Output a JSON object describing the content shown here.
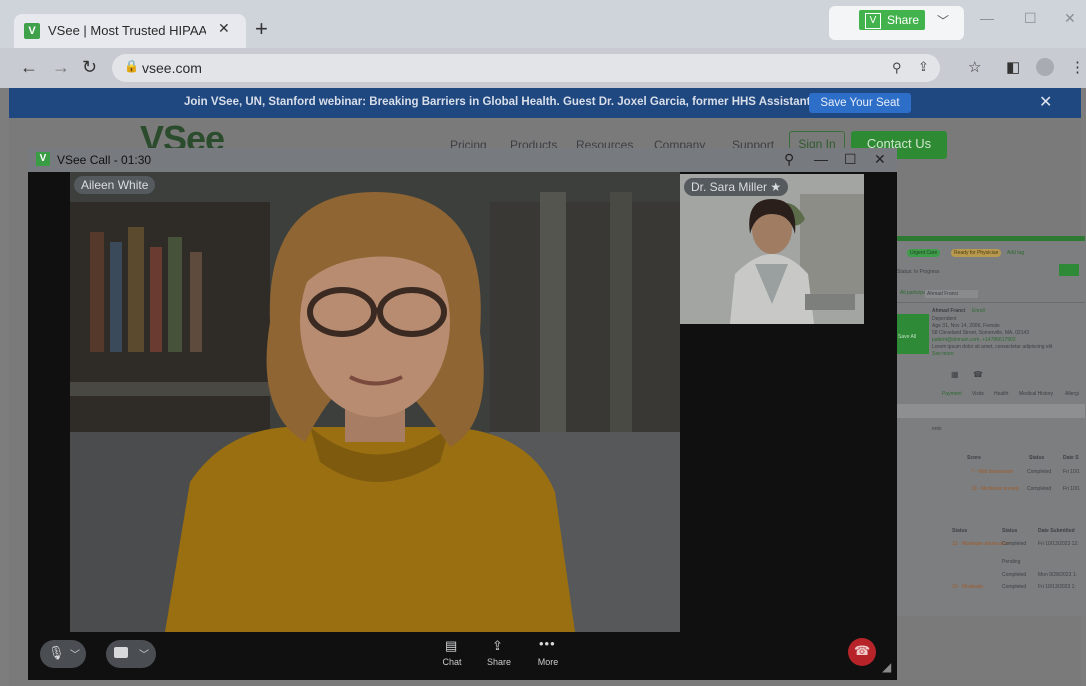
{
  "browser": {
    "tab_title": "VSee | Most Trusted HIPAA Com",
    "url": "vsee.com",
    "share_label": "Share"
  },
  "banner": {
    "message": "Join VSee, UN, Stanford webinar: Breaking Barriers in Global Health. Guest Dr. Joxel Garcia, former HHS Assistant Secretary",
    "cta": "Save Your Seat"
  },
  "site": {
    "logo": "VSee",
    "nav": [
      "Pricing",
      "Products",
      "Resources",
      "Company",
      "Support"
    ],
    "sign_in": "Sign In",
    "contact": "Contact Us",
    "panel": {
      "tag1": "Urgent Care",
      "tag2": "Ready for Physician",
      "add": "Add tag",
      "status": "Status: In Progress",
      "filter": "All participants",
      "filter_value": "Ahmad Franci",
      "patient": "Ahmad Franci",
      "patient_badge": "Enroll",
      "dependent": "Dependent",
      "age": "Age 31, Nov 14, 2006, Female",
      "address": "58 Cleveland Street, Somerville, MA, 02143",
      "contact": "patient@domain.com, +14786617902",
      "lorem": "Lorem ipsum dolor sit amet, consectetur adipiscing elit",
      "see_more": "See more",
      "tabs": [
        "Payment",
        "Visits",
        "Health",
        "Medical History",
        "Allergi"
      ],
      "section": "ents",
      "cols1": [
        "Score",
        "Status",
        "Date S"
      ],
      "rows1": [
        [
          "7 - Mild depression",
          "Completed",
          "Fri 10/1"
        ],
        [
          "10 - Moderate anxiety",
          "Completed",
          "Fri 10/1"
        ]
      ],
      "cols2": [
        "Status",
        "Status",
        "Date Submitted"
      ],
      "rows2": [
        [
          "12 - Moderate depression",
          "Completed",
          "Fri 10/13/2023 12:"
        ],
        [
          "",
          "Pending",
          ""
        ],
        [
          "",
          "Completed",
          "Mon 9/28/2023 1:"
        ],
        [
          "10 - Moderate",
          "Completed",
          "Fri 10/13/2023 1:"
        ]
      ],
      "save_all": "Save All"
    }
  },
  "call": {
    "title": "VSee Call - 01:30",
    "main_participant": "Aileen White",
    "pip_participant": "Dr. Sara Miller",
    "controls": {
      "chat": "Chat",
      "share": "Share",
      "more": "More"
    }
  },
  "icons": {
    "mic": "microphone-icon",
    "camera": "camera-icon",
    "end": "hang-up-icon"
  },
  "colors": {
    "vsee_green": "#42b34c",
    "banner_blue": "#1f4780",
    "end_call_red": "#b6242a"
  }
}
